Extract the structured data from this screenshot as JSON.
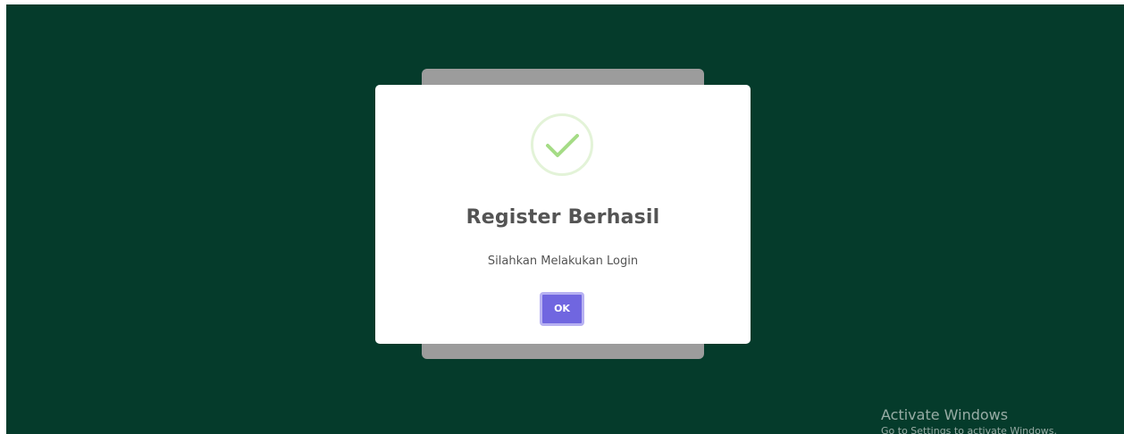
{
  "colors": {
    "background": "#053b2b",
    "backdrop_card": "#9c9c9c",
    "dialog": "#ffffff",
    "success_green": "#a5dc86",
    "button": "#7066e0"
  },
  "dialog": {
    "icon": "checkmark-icon",
    "title": "Register Berhasil",
    "text": "Silahkan Melakukan Login",
    "ok_label": "OK"
  },
  "watermark": {
    "title": "Activate Windows",
    "subtitle": "Go to Settings to activate Windows."
  }
}
